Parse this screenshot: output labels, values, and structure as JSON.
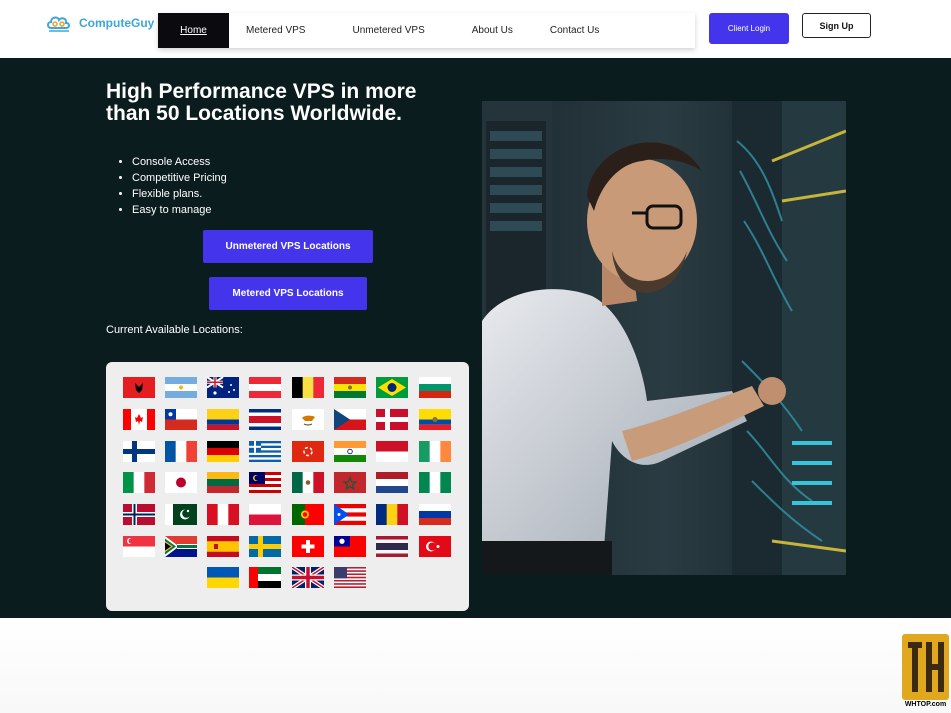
{
  "brand": {
    "name": "ComputeGuy",
    "accent": "#3aa7d8"
  },
  "nav": {
    "home": "Home",
    "metered": "Metered VPS",
    "unmetered": "Unmetered VPS",
    "about": "About Us",
    "contact": "Contact Us"
  },
  "header_buttons": {
    "client_login": "Client Login",
    "sign_up": "Sign Up"
  },
  "hero": {
    "title": "High Performance VPS in more than 50 Locations Worldwide.",
    "features": [
      "Console Access",
      "Competitive Pricing",
      "Flexible plans.",
      "Easy to manage"
    ],
    "btn_unmetered": "Unmetered VPS Locations",
    "btn_metered": "Metered VPS Locations",
    "locations_label": "Current Available Locations:"
  },
  "flags": [
    [
      "albania",
      "argentina",
      "australia",
      "austria",
      "belgium",
      "bolivia",
      "brazil",
      "bulgaria"
    ],
    [
      "canada",
      "chile",
      "colombia",
      "costa-rica",
      "cyprus",
      "czechia",
      "denmark",
      "ecuador"
    ],
    [
      "finland",
      "france",
      "germany",
      "greece",
      "hong-kong",
      "india",
      "indonesia",
      "ireland"
    ],
    [
      "italy",
      "japan",
      "lithuania",
      "malaysia",
      "mexico",
      "morocco",
      "netherlands",
      "nigeria"
    ],
    [
      "norway",
      "pakistan",
      "peru",
      "poland",
      "portugal",
      "puerto-rico",
      "romania",
      "russia"
    ],
    [
      "singapore",
      "south-africa",
      "spain",
      "sweden",
      "switzerland",
      "taiwan",
      "thailand",
      "turkey"
    ],
    [
      "",
      "",
      "ukraine",
      "uae",
      "united-kingdom",
      "united-states",
      "",
      ""
    ]
  ],
  "colors": {
    "hero_bg": "#0b1c1f",
    "primary_button": "#4435ec",
    "panel_bg": "#eeeeee"
  },
  "watermark": {
    "text": "WHTOP.com"
  }
}
